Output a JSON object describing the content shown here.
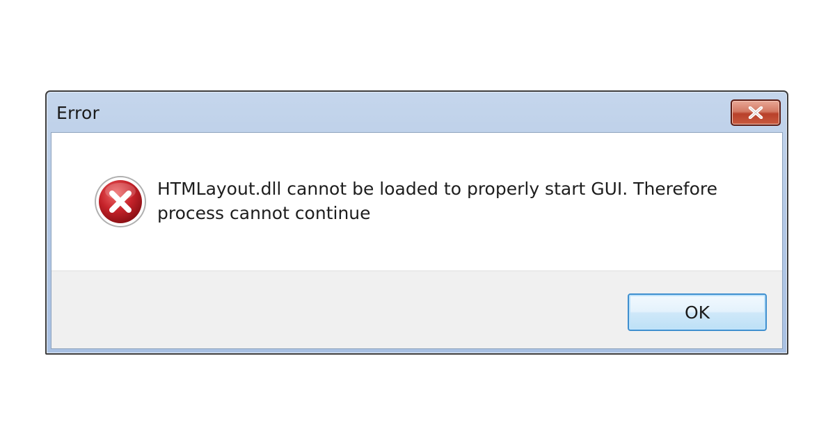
{
  "dialog": {
    "title": "Error",
    "close_icon": "close-x-icon",
    "status_icon": "error-icon",
    "message": "HTMLayout.dll cannot be loaded to properly start GUI. Therefore process cannot continue",
    "ok_label": "OK"
  },
  "colors": {
    "titlebar": "#b4c9e6",
    "close_button": "#c75238",
    "error_icon": "#c6232a",
    "ok_border": "#3f8fcf",
    "button_area": "#f0f0f0"
  }
}
